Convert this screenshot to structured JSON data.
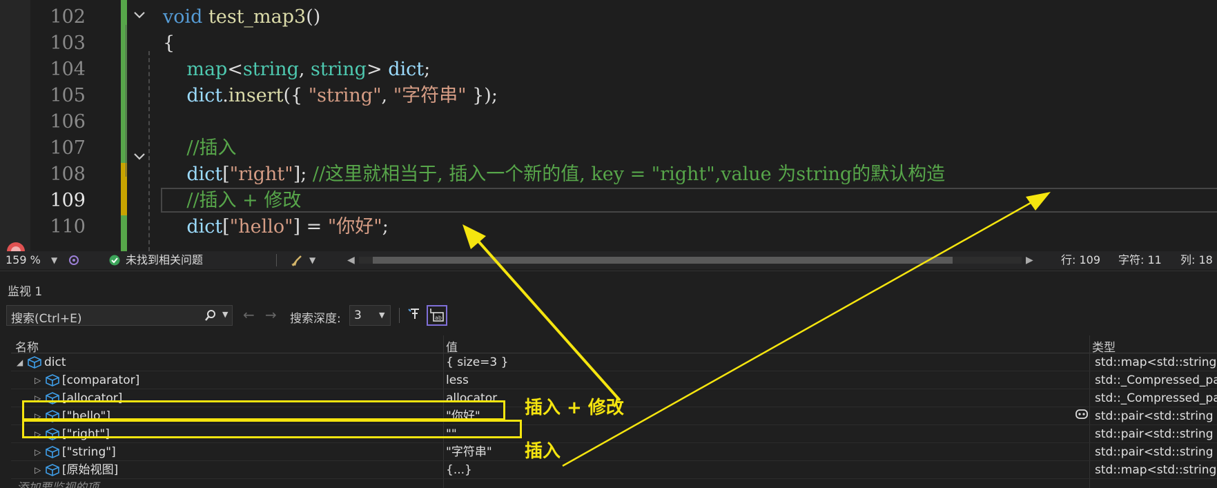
{
  "editor": {
    "lines": [
      {
        "no": "102",
        "tokens": [
          [
            "kw",
            "void "
          ],
          [
            "fn",
            "test_map3"
          ],
          [
            "",
            "()"
          ]
        ]
      },
      {
        "no": "103",
        "tokens": [
          [
            "",
            "{"
          ]
        ]
      },
      {
        "no": "104",
        "tokens": [
          [
            "",
            "    "
          ],
          [
            "ty",
            "map"
          ],
          [
            "",
            "<"
          ],
          [
            "ty",
            "string"
          ],
          [
            "",
            ", "
          ],
          [
            "ty",
            "string"
          ],
          [
            "",
            "> "
          ],
          [
            "var",
            "dict"
          ],
          [
            "",
            ";"
          ]
        ]
      },
      {
        "no": "105",
        "tokens": [
          [
            "",
            "    "
          ],
          [
            "var",
            "dict"
          ],
          [
            "",
            "."
          ],
          [
            "fn",
            "insert"
          ],
          [
            "",
            "({ "
          ],
          [
            "str",
            "\"string\""
          ],
          [
            "",
            ", "
          ],
          [
            "str",
            "\"字符串\""
          ],
          [
            "",
            " });"
          ]
        ]
      },
      {
        "no": "106",
        "tokens": [
          [
            "",
            ""
          ]
        ]
      },
      {
        "no": "107",
        "tokens": [
          [
            "",
            "    "
          ],
          [
            "cm",
            "//插入"
          ]
        ]
      },
      {
        "no": "108",
        "tokens": [
          [
            "",
            "    "
          ],
          [
            "var",
            "dict"
          ],
          [
            "",
            "["
          ],
          [
            "str",
            "\"right\""
          ],
          [
            "",
            "]; "
          ],
          [
            "cm",
            "//这里就相当于, 插入一个新的值, key = \"right\",value 为string的默认构造"
          ]
        ]
      },
      {
        "no": "109",
        "tokens": [
          [
            "",
            "    "
          ],
          [
            "cm",
            "//插入 + 修改"
          ]
        ]
      },
      {
        "no": "110",
        "tokens": [
          [
            "",
            "    "
          ],
          [
            "var",
            "dict"
          ],
          [
            "",
            "["
          ],
          [
            "str",
            "\"hello\""
          ],
          [
            "",
            "] = "
          ],
          [
            "str",
            "\"你好\""
          ],
          [
            "",
            ";"
          ]
        ]
      }
    ],
    "current_line": "109"
  },
  "statusbar": {
    "zoom": "159 %",
    "issues": "未找到相关问题",
    "line": "行: 109",
    "char": "字符: 11",
    "col": "列: 18"
  },
  "watch": {
    "title": "监视 1",
    "search_placeholder": "搜索(Ctrl+E)",
    "depth_label": "搜索深度:",
    "depth_value": "3",
    "headers": {
      "name": "名称",
      "value": "值",
      "type": "类型"
    },
    "rows": [
      {
        "name": "dict",
        "value": "{ size=3 }",
        "type": "std::map<std::string,std::string>",
        "expander": "◢",
        "indent": 0
      },
      {
        "name": "[comparator]",
        "value": "less",
        "type": "std::_Compressed_pair",
        "expander": "▷",
        "indent": 1
      },
      {
        "name": "[allocator]",
        "value": "allocator",
        "type": "std::_Compressed_pair",
        "expander": "▷",
        "indent": 1
      },
      {
        "name": "[\"hello\"]",
        "value": "\"你好\"",
        "type": "std::pair<std::string const",
        "expander": "▷",
        "indent": 1
      },
      {
        "name": "[\"right\"]",
        "value": "\"\"",
        "type": "std::pair<std::string const",
        "expander": "▷",
        "indent": 1
      },
      {
        "name": "[\"string\"]",
        "value": "\"字符串\"",
        "type": "std::pair<std::string const",
        "expander": "▷",
        "indent": 1
      },
      {
        "name": "[原始视图]",
        "value": "{...}",
        "type": "std::map<std::string,std::string>",
        "expander": "▷",
        "indent": 1
      }
    ],
    "add_item": "添加要监视的项"
  },
  "annotations": {
    "insert_modify": "插入 + 修改",
    "insert": "插入"
  },
  "colors": {
    "highlight": "#f5e50f",
    "change_bar": "#57a64a",
    "modified_bar": "#c8a400"
  }
}
